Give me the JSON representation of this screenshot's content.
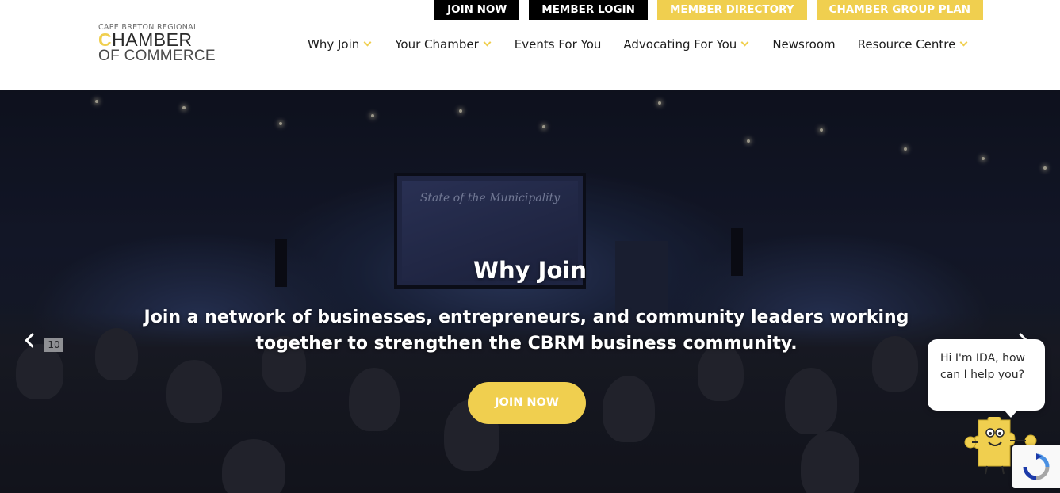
{
  "topbar": {
    "join_now": "JOIN NOW",
    "member_login": "MEMBER LOGIN",
    "member_directory": "MEMBER DIRECTORY",
    "group_plan": "CHAMBER GROUP PLAN"
  },
  "logo": {
    "line1": "CAPE BRETON REGIONAL",
    "line2": "HAMBER",
    "line2_initial": "C",
    "line3": "OF COMMERCE"
  },
  "nav": {
    "items": [
      {
        "label": "Why Join",
        "dropdown": true
      },
      {
        "label": "Your Chamber",
        "dropdown": true
      },
      {
        "label": "Events For You",
        "dropdown": false
      },
      {
        "label": "Advocating For You",
        "dropdown": true
      },
      {
        "label": "Newsroom",
        "dropdown": false
      },
      {
        "label": "Resource Centre",
        "dropdown": true
      }
    ]
  },
  "hero": {
    "title": "Why Join",
    "subtitle": "Join a network of businesses, entrepreneurs, and community leaders working together to strengthen the CBRM business community.",
    "button": "JOIN NOW",
    "photo_screen_text": "State of the Municipality",
    "photo_table_number": "10"
  },
  "chat": {
    "greeting": "Hi I'm IDA, how can I help you?"
  },
  "colors": {
    "accent": "#f0cf4f",
    "dark_button": "#000000"
  }
}
